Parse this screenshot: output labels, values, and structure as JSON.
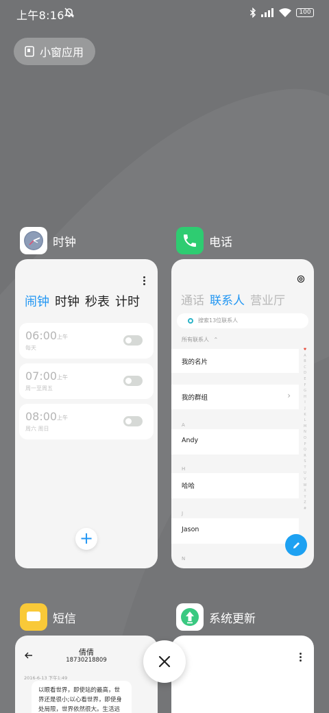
{
  "status_bar": {
    "time": "上午8:16",
    "battery": "100"
  },
  "mini_window": {
    "label": "小窗应用"
  },
  "clock_app": {
    "name": "时钟",
    "tabs": [
      {
        "label": "闹钟",
        "active": true
      },
      {
        "label": "时钟",
        "active": false
      },
      {
        "label": "秒表",
        "active": false
      },
      {
        "label": "计时",
        "active": false
      }
    ],
    "alarms": [
      {
        "time": "06:00",
        "ampm": "上午",
        "repeat": "每天",
        "enabled": false
      },
      {
        "time": "07:00",
        "ampm": "上午",
        "repeat": "周一至周五",
        "enabled": false
      },
      {
        "time": "08:00",
        "ampm": "上午",
        "repeat": "周六 周日",
        "enabled": false
      }
    ],
    "add_label": "+"
  },
  "phone_app": {
    "name": "电话",
    "tabs": [
      {
        "label": "通话",
        "active": false
      },
      {
        "label": "联系人",
        "active": true
      },
      {
        "label": "营业厅",
        "active": false
      }
    ],
    "search_placeholder": "搜索13位联系人",
    "all_contacts": "所有联系人",
    "rows": [
      {
        "name": "我的名片"
      },
      {
        "name": "我的群组"
      },
      {
        "letter": "A",
        "name": "Andy"
      },
      {
        "letter": "H",
        "name": "哈哈"
      },
      {
        "letter": "J",
        "name": "Jason"
      },
      {
        "letter": "N"
      }
    ],
    "alphabet": [
      "♥",
      "A",
      "B",
      "C",
      "D",
      "E",
      "F",
      "G",
      "H",
      "I",
      "J",
      "K",
      "L",
      "M",
      "N",
      "O",
      "P",
      "Q",
      "R",
      "S",
      "T",
      "U",
      "V",
      "W",
      "X",
      "Y",
      "Z",
      "#"
    ]
  },
  "sms_app": {
    "name": "短信",
    "contact": "倩倩",
    "number": "18730218809",
    "date": "2016-6-13 下午1:49",
    "message_lines": [
      "以眼看世界，即使站的最高，世",
      "界还是很小;以心看世界，即使身",
      "处局限，世界依然很大。生活远"
    ]
  },
  "update_app": {
    "name": "系统更新"
  },
  "colors": {
    "accent": "#2196f3",
    "phone_icon": "#2ecc71",
    "sms_icon": "#f9c938",
    "update_icon": "#3ac981",
    "background": "#727375"
  },
  "icons": {
    "mute": "bell-off-icon",
    "bluetooth": "bluetooth-icon",
    "signal": "signal-icon",
    "wifi": "wifi-icon",
    "close": "close-icon"
  }
}
